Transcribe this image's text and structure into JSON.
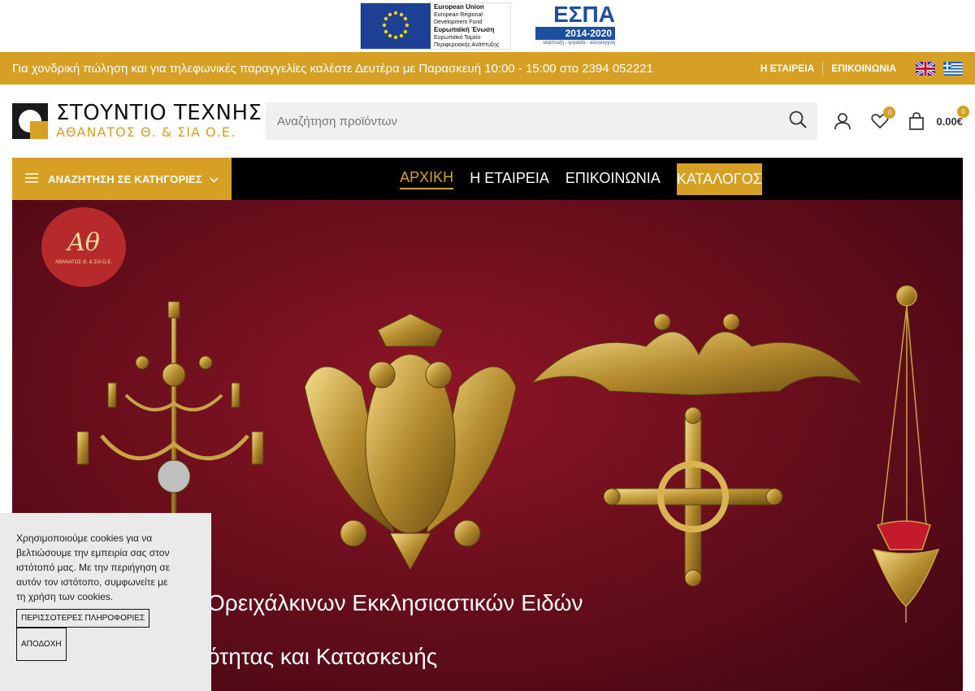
{
  "eu_banner": {
    "eu_line1": "European Union",
    "eu_line2": "European Regional",
    "eu_line3": "Development Fund",
    "eu_line4": "Ευρωπαϊκή Ένωση",
    "eu_line5": "Ευρωπαϊκό Ταμείο",
    "eu_line6": "Περιφερειακής Ανάπτυξης",
    "espa_title": "ΕΣΠΑ",
    "espa_years": "2014-2020",
    "espa_tagline": "ανάπτυξη - εργασία - αλληλεγγύη"
  },
  "top_bar": {
    "info_text": "Για χονδρική πώληση και για τηλεφωνικές παραγγελίες καλέστε Δευτέρα με Παρασκευή 10:00 - 15:00 στο 2394 052221",
    "link_company": "Η ΕΤΑΙΡΕΙΑ",
    "link_contact": "ΕΠΙΚΟΙΝΩΝΙΑ",
    "lang_en": "english-flag-icon",
    "lang_gr": "greek-flag-icon"
  },
  "header": {
    "logo_title": "ΣΤΟΥΝΤΙΟ ΤΕΧΝΗΣ",
    "logo_subtitle": "ΑΘΑΝΑΤΟΣ Θ. & ΣΙΑ Ο.Ε.",
    "search_placeholder": "Αναζήτηση προϊόντων",
    "wishlist_count": "0",
    "cart_count": "0",
    "cart_total": "0.00€"
  },
  "nav": {
    "categories_label": "ΑΝΑΖΗΤΗΣΗ ΣΕ ΚΑΤΗΓΟΡΙΕΣ",
    "items": [
      {
        "label": "ΑΡΧΙΚΗ"
      },
      {
        "label": "Η ΕΤΑΙΡΕΙΑ"
      },
      {
        "label": "ΕΠΙΚΟΙΝΩΝΙΑ"
      },
      {
        "label": "ΚΑΤΑΛΟΓΟΣ"
      }
    ]
  },
  "hero": {
    "badge_monogram": "Αθ",
    "badge_caption": "ΑΘΑΝΑΤΟΣ Θ. & ΣΙΑ Ο.Ε.",
    "line1": "Ορειχάλκινων Εκκλησιαστικών Ειδών",
    "line2": "ότητας και Κατασκευής"
  },
  "cookie": {
    "text": "Χρησιμοποιούμε cookies για να βελτιώσουμε την εμπειρία σας στον ιστότοπό μας. Με την περιήγηση σε αυτόν τον ιστότοπο, συμφωνείτε με τη χρήση των cookies.",
    "more_label": "ΠΕΡΙΣΣΟΤΕΡΕΣ ΠΛΗΡΟΦΟΡΙΕΣ",
    "accept_label": "ΑΠΟΔΟΧΗ"
  },
  "colors": {
    "accent_gold": "#d6a024",
    "nav_black": "#000000",
    "hero_red": "#7a1020"
  }
}
